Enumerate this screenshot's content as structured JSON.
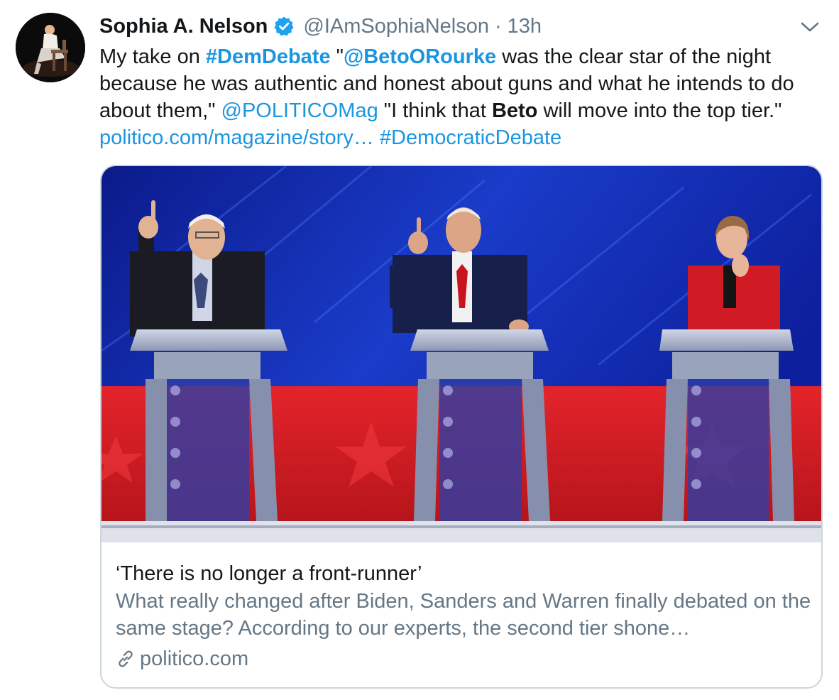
{
  "tweet": {
    "display_name": "Sophia A. Nelson",
    "handle": "@IAmSophiaNelson",
    "separator": "·",
    "time": "13h",
    "text": {
      "s1": "My take on ",
      "h1": "#DemDebate",
      "s2": " \"",
      "h2": "@BetoORourke",
      "s3": " was the clear star of the night because he was authentic and honest about guns and what he intends to do about them,\" ",
      "l1": "@POLITICOMag",
      "s4": " \"I think that ",
      "b1": "Beto",
      "s5": " will move into the top tier.\" ",
      "l2": "politico.com/magazine/story…",
      "s6": " ",
      "l3": "#DemocraticDebate"
    }
  },
  "card": {
    "title": "‘There is no longer a front-runner’",
    "description": "What really changed after Biden, Sanders and Warren finally debated on the same stage? According to our experts, the second tier shone…",
    "domain": "politico.com"
  },
  "icons": {
    "verified": "verified-badge-icon",
    "caret": "chevron-down-icon",
    "link": "link-icon"
  },
  "colors": {
    "link": "#1b95e0",
    "secondary_text": "#657786",
    "border": "#ccd6dd",
    "verified": "#1da1f2"
  }
}
